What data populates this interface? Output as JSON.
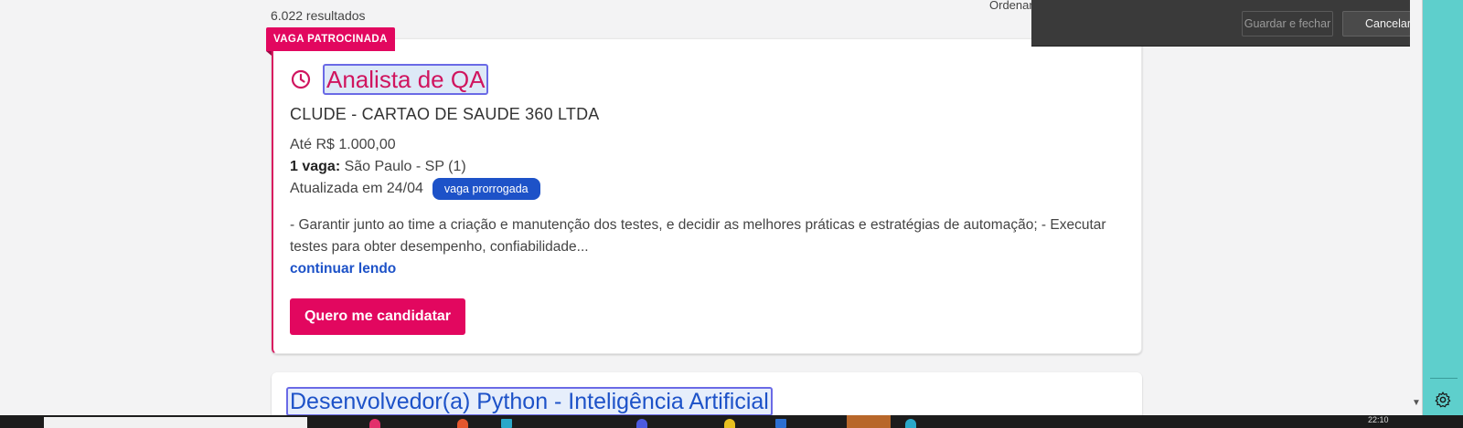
{
  "results": {
    "count_text": "6.022 resultados",
    "sort_label": "Ordenar"
  },
  "sponsored_card": {
    "badge": "VAGA PATROCINADA",
    "title": "Analista de QA",
    "company": "CLUDE - CARTAO DE SAUDE 360 LTDA",
    "salary": "Até R$ 1.000,00",
    "vacancy_count": "1 vaga:",
    "location": "São Paulo - SP (1)",
    "updated": "Atualizada em 24/04",
    "status_pill": "vaga prorrogada",
    "description": "- Garantir junto ao time a criação e manutenção dos testes, e decidir as melhores práticas e estratégias de automação; - Executar testes para obter desempenho, confiabilidade...",
    "read_more": "continuar lendo",
    "apply_button": "Quero me candidatar"
  },
  "next_card": {
    "title": "Desenvolvedor(a) Python - Inteligência Artificial"
  },
  "popup": {
    "save_label": "Guardar e fechar",
    "cancel_label": "Cancelar"
  },
  "taskbar": {
    "clock": "22:10"
  },
  "colors": {
    "accent_pink": "#e2075f",
    "link_blue": "#1d52c8",
    "background_teal": "#5ecfcc"
  },
  "icons": {
    "title_icon": "clock-icon",
    "settings_icon": "gear-icon"
  }
}
